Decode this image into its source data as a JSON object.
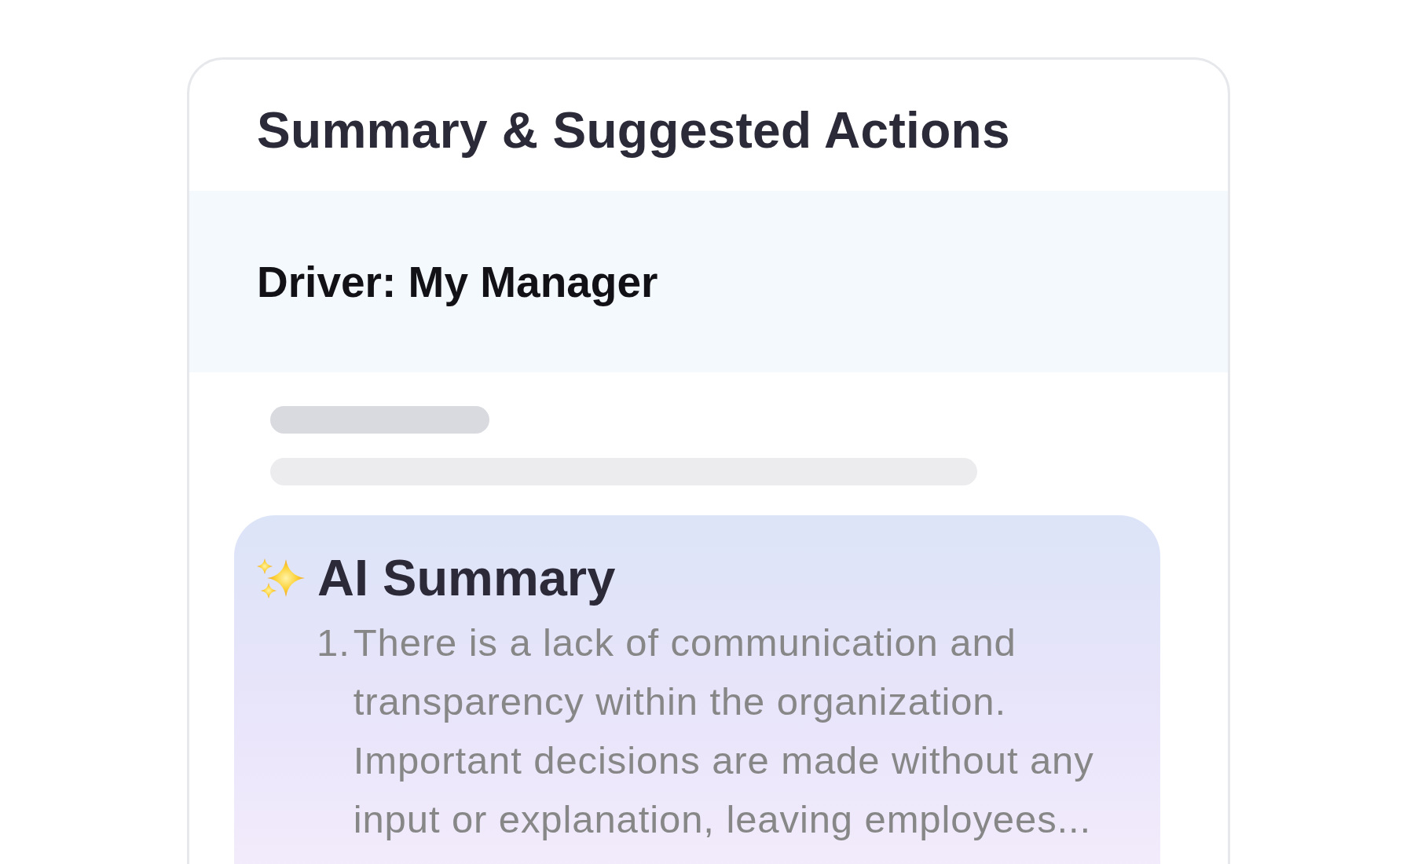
{
  "card": {
    "title": "Summary & Suggested Actions",
    "driver": {
      "label": "Driver: My Manager"
    },
    "placeholder_lines": [
      {
        "kind": "short"
      },
      {
        "kind": "long"
      }
    ],
    "ai_summary": {
      "title": "AI Summary",
      "items": [
        {
          "number": "1.",
          "text": "There is a lack of communication and transparency within the organization. Important decisions are made without any input or explanation, leaving employees..."
        }
      ]
    }
  }
}
